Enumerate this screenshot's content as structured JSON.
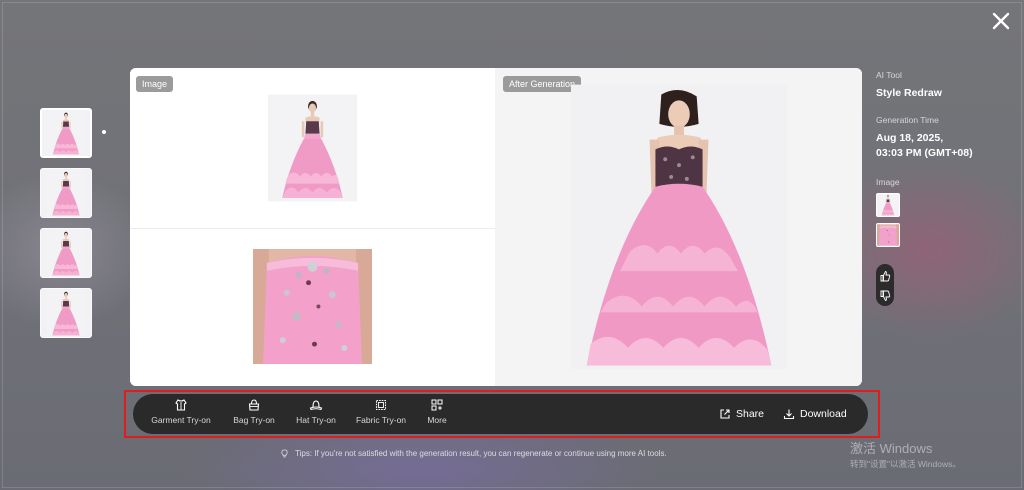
{
  "thumbnails": {
    "count": 4,
    "active_index": 0
  },
  "card": {
    "left_label": "Image",
    "right_label": "After Generation"
  },
  "info": {
    "tool_label": "AI Tool",
    "tool_value": "Style Redraw",
    "time_label": "Generation Time",
    "time_line1": "Aug 18, 2025,",
    "time_line2": "03:03 PM (GMT+08)",
    "image_label": "Image"
  },
  "toolbar": {
    "tools": [
      {
        "label": "Garment Try-on",
        "icon": "garment-icon"
      },
      {
        "label": "Bag Try-on",
        "icon": "bag-icon"
      },
      {
        "label": "Hat Try-on",
        "icon": "hat-icon"
      },
      {
        "label": "Fabric Try-on",
        "icon": "fabric-icon"
      },
      {
        "label": "More",
        "icon": "more-grid-icon"
      }
    ],
    "share_label": "Share",
    "download_label": "Download"
  },
  "tips": "Tips: If you're not satisfied with the generation result, you can regenerate or continue using more AI tools.",
  "watermark": {
    "line1": "激活 Windows",
    "line2": "转到\"设置\"以激活 Windows。"
  },
  "colors": {
    "toolbar_bg": "#2a2a2a",
    "highlight_outline": "#e21b1b",
    "dress_pink": "#f09ac6",
    "bodice": "#5a3a4a"
  }
}
